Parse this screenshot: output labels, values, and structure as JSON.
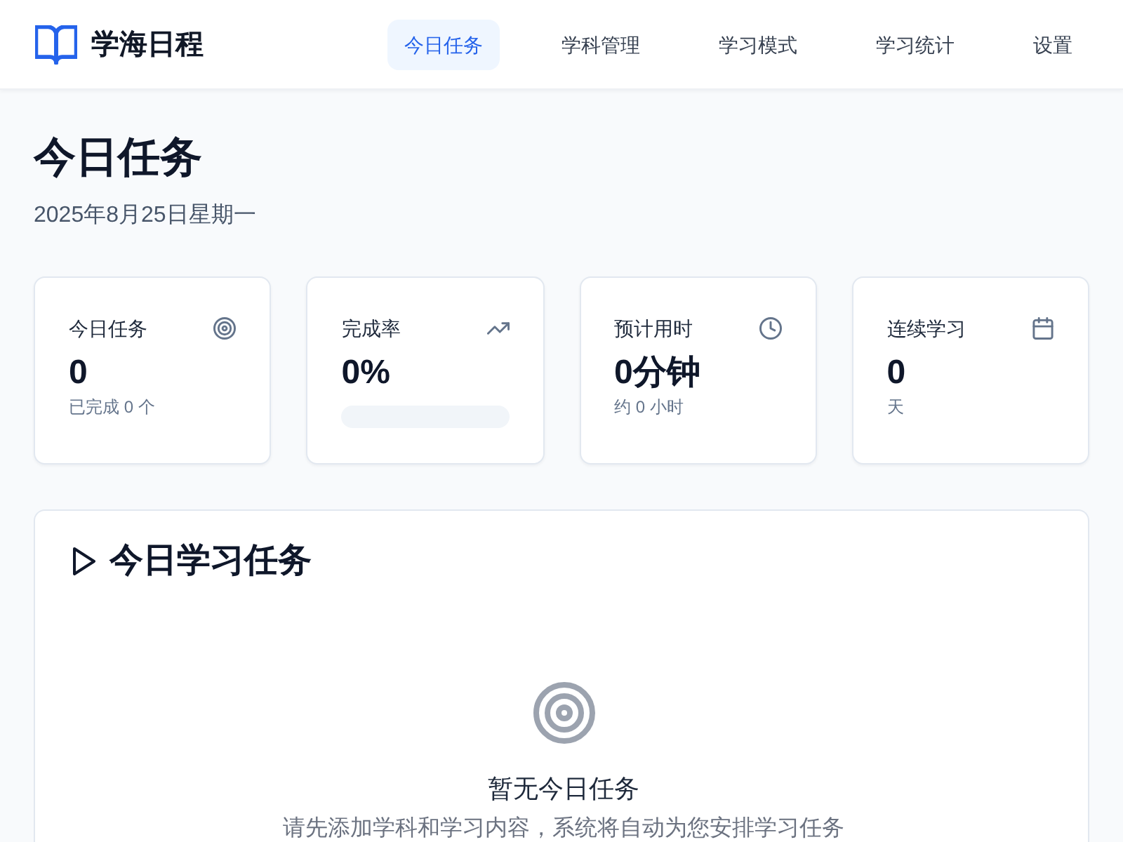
{
  "app": {
    "title": "学海日程"
  },
  "nav": [
    {
      "label": "今日任务",
      "selected": true
    },
    {
      "label": "学科管理",
      "selected": false
    },
    {
      "label": "学习模式",
      "selected": false
    },
    {
      "label": "学习统计",
      "selected": false
    },
    {
      "label": "设置",
      "selected": false
    }
  ],
  "page": {
    "title": "今日任务",
    "date": "2025年8月25日星期一"
  },
  "stats": [
    {
      "kind": "note",
      "label": "今日任务",
      "value": "0",
      "note": "已完成 0 个"
    },
    {
      "kind": "progress",
      "label": "完成率",
      "value": "0%"
    },
    {
      "kind": "note",
      "label": "预计用时",
      "value": "0分钟",
      "note": "约 0 小时"
    },
    {
      "kind": "note",
      "label": "连续学习",
      "value": "0",
      "note": "天"
    }
  ],
  "tasks": {
    "title": "今日学习任务",
    "empty_title": "暂无今日任务",
    "empty_hint": "请先添加学科和学习内容，系统将自动为您安排学习任务"
  }
}
